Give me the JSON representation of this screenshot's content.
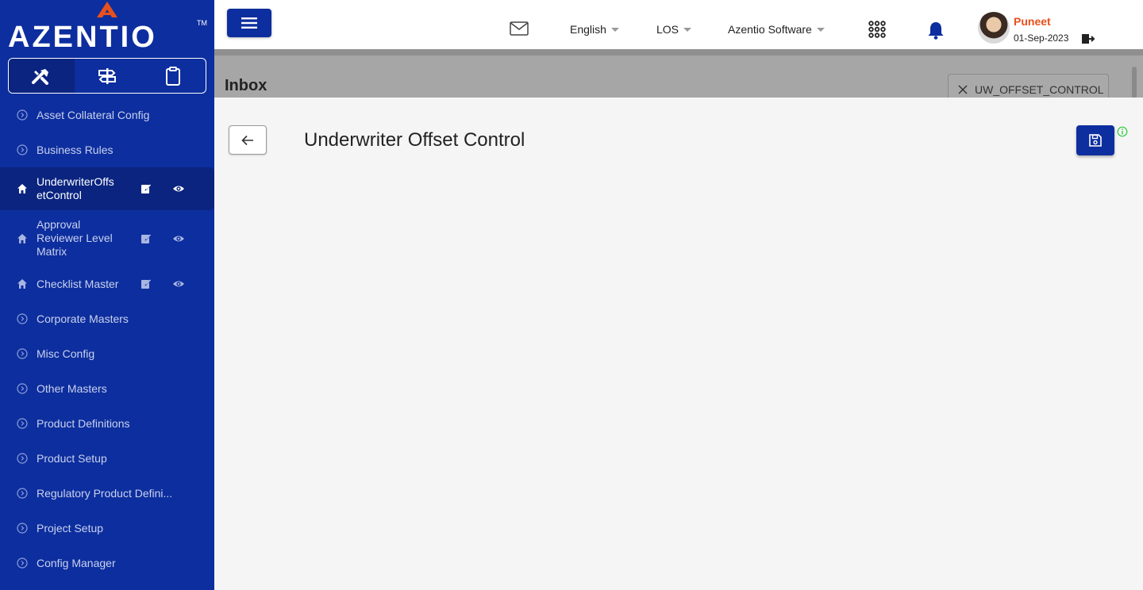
{
  "brand": {
    "logo_text": "AZENTIO",
    "tm": "TM"
  },
  "sidebar": {
    "modes": [
      {
        "icon": "tools-icon",
        "active": true
      },
      {
        "icon": "signpost-icon",
        "active": false
      },
      {
        "icon": "clipboard-icon",
        "active": false
      }
    ],
    "items": [
      {
        "label": "Asset Collateral Config"
      },
      {
        "label": "Business Rules"
      },
      {
        "label_line1": "UnderwriterOffs",
        "label_line2": "etControl"
      },
      {
        "label_line1": "Approval",
        "label_line2": "Reviewer Level",
        "label_line3": "Matrix"
      },
      {
        "label": "Checklist Master"
      },
      {
        "label": "Corporate Masters"
      },
      {
        "label": "Misc Config"
      },
      {
        "label": "Other Masters"
      },
      {
        "label": "Product Definitions"
      },
      {
        "label": "Product Setup"
      },
      {
        "label": "Regulatory Product Defini..."
      },
      {
        "label": "Project Setup"
      },
      {
        "label": "Config Manager"
      }
    ]
  },
  "header": {
    "language": "English",
    "module": "LOS",
    "company": "Azentio Software",
    "user_name": "Puneet",
    "user_date": "01-Sep-2023"
  },
  "inbox": {
    "title": "Inbox",
    "tab_label": "UW_OFFSET_CONTROL"
  },
  "page": {
    "title": "Underwriter Offset Control"
  },
  "colors": {
    "sidebar_bg": "#0d2e9e",
    "accent": "#0d2e9e",
    "user_name": "#e8501c",
    "info": "#2ecc40"
  }
}
